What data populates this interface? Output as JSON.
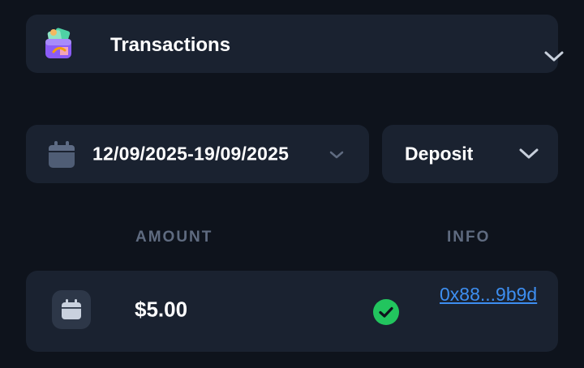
{
  "section": {
    "title": "Transactions",
    "icon": "wallet-icon",
    "chevron": "chevron-down-icon"
  },
  "filters": {
    "date_range": "12/09/2025-19/09/2025",
    "date_icon": "calendar-icon",
    "type_selected": "Deposit"
  },
  "table": {
    "columns": [
      "AMOUNT",
      "INFO"
    ],
    "rows": [
      {
        "type_icon": "calendar-icon",
        "amount": "$5.00",
        "status_icon": "check-circle-icon",
        "info_link": "0x88...9b9d"
      }
    ]
  },
  "colors": {
    "background": "#0e131c",
    "card": "#1a2230",
    "muted_text": "#5f6b80",
    "link": "#3d8ef0",
    "success": "#22c55e"
  }
}
